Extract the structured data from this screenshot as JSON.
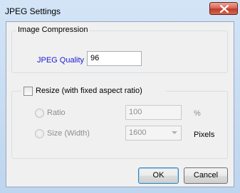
{
  "window": {
    "title": "JPEG Settings"
  },
  "image_compression": {
    "group_label": "Image Compression",
    "quality_label": "JPEG Quality",
    "quality_value": "96"
  },
  "resize": {
    "checkbox_label": "Resize (with fixed aspect ratio)",
    "checked": false,
    "ratio_label": "Ratio",
    "ratio_value": "100",
    "ratio_unit": "%",
    "size_label": "Size (Width)",
    "size_value": "1600",
    "size_unit": "Pixels"
  },
  "buttons": {
    "ok": "OK",
    "cancel": "Cancel"
  },
  "icons": {
    "close": "close-icon",
    "combo": "chevron-down-icon"
  },
  "colors": {
    "label_accent": "#1a1ad6",
    "close_button": "#c23a2a"
  }
}
